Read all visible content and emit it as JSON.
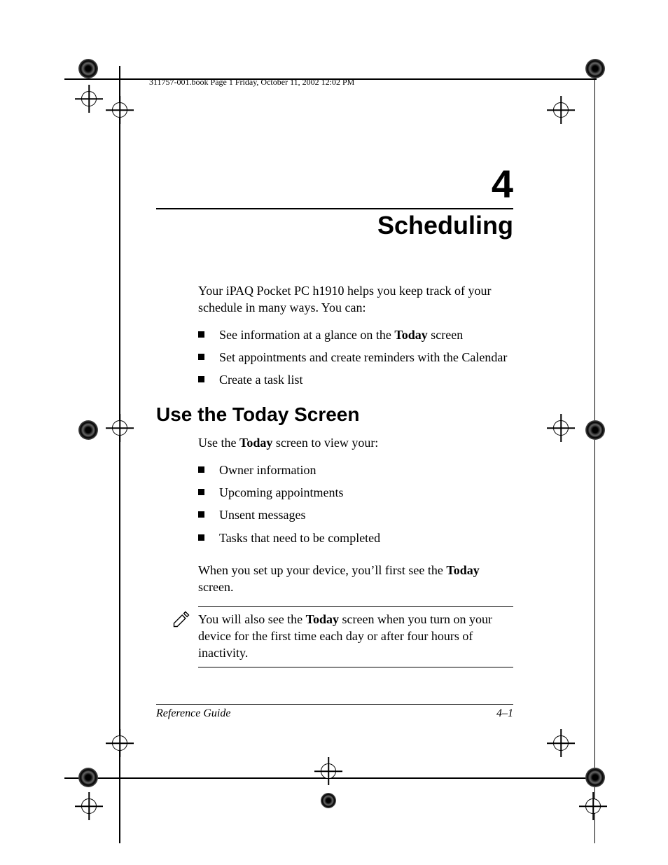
{
  "header_stamp": "311757-001.book  Page 1  Friday, October 11, 2002  12:02 PM",
  "chapter_number": "4",
  "chapter_title": "Scheduling",
  "intro_prefix": "Your iPAQ Pocket PC h1910 helps you keep track of your schedule in many ways. You can:",
  "intro_bullets": [
    {
      "pre": "See information at a glance on the ",
      "bold": "Today",
      "post": " screen"
    },
    {
      "pre": "Set appointments and create reminders with the Calendar",
      "bold": "",
      "post": ""
    },
    {
      "pre": "Create a task list",
      "bold": "",
      "post": ""
    }
  ],
  "section_heading": "Use the Today Screen",
  "section_intro_pre": "Use the ",
  "section_intro_bold": "Today",
  "section_intro_post": " screen to view your:",
  "section_bullets": [
    "Owner information",
    "Upcoming appointments",
    "Unsent messages",
    "Tasks that need to be completed"
  ],
  "closing_pre": "When you set up your device, you’ll first see the ",
  "closing_bold": "Today",
  "closing_post": " screen.",
  "note_pre": "You will also see the ",
  "note_bold": "Today",
  "note_post": " screen when you turn on your device for the first time each day or after four hours of inactivity.",
  "footer_left": "Reference Guide",
  "footer_right": "4–1"
}
